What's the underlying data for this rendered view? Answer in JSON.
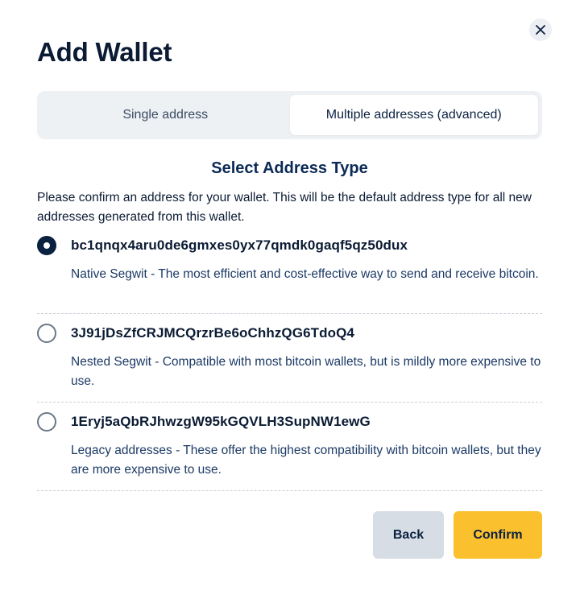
{
  "dialog": {
    "title": "Add Wallet",
    "close_icon": "close-icon"
  },
  "tabs": [
    {
      "label": "Single address",
      "active": false
    },
    {
      "label": "Multiple addresses (advanced)",
      "active": true
    }
  ],
  "section": {
    "title": "Select Address Type",
    "intro": "Please confirm an address for your wallet. This will be the default address type for all new addresses generated from this wallet."
  },
  "options": [
    {
      "address": "bc1qnqx4aru0de6gmxes0yx77qmdk0gaqf5qz50dux",
      "description": "Native Segwit - The most efficient and cost-effective way to send and receive bitcoin.",
      "selected": true
    },
    {
      "address": "3J91jDsZfCRJMCQrzrBe6oChhzQG6TdoQ4",
      "description": "Nested Segwit - Compatible with most bitcoin wallets, but is mildly more expensive to use.",
      "selected": false
    },
    {
      "address": "1Eryj5aQbRJhwzgW95kGQVLH3SupNW1ewG",
      "description": "Legacy addresses - These offer the highest compatibility with bitcoin wallets, but they are more expensive to use.",
      "selected": false
    }
  ],
  "actions": {
    "back_label": "Back",
    "confirm_label": "Confirm"
  },
  "colors": {
    "primary": "#0b2140",
    "confirm": "#fbc02d",
    "back": "#d7dde4"
  }
}
